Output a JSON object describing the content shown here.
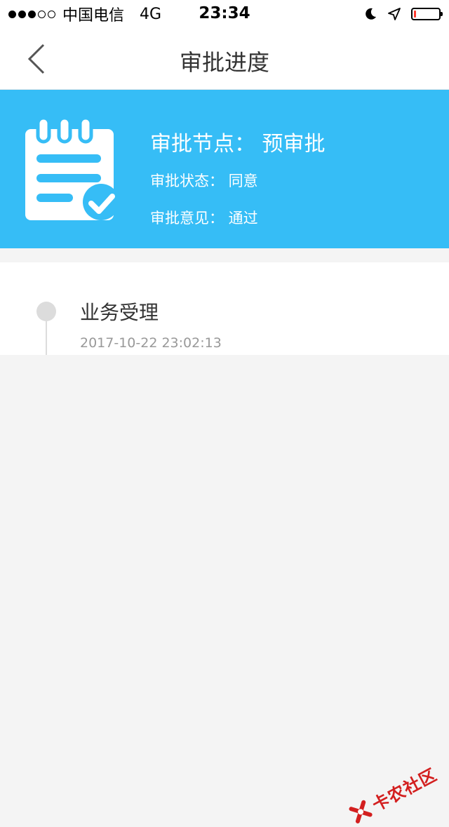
{
  "status_bar": {
    "carrier": "中国电信",
    "network": "4G",
    "time": "23:34",
    "signal_bars_filled": 3,
    "signal_bars_total": 5,
    "battery_level": 0.1,
    "battery_color": "#ff3b30",
    "icons": [
      "moon-icon",
      "location-arrow-icon",
      "battery-icon"
    ]
  },
  "nav": {
    "title": "审批进度",
    "back_icon": "chevron-left-icon"
  },
  "banner": {
    "background": "#36bdf6",
    "icon": "clipboard-check-icon",
    "node": "审批节点：  预审批",
    "status": "审批状态：  同意",
    "opinion": "审批意见：  通过"
  },
  "timeline": {
    "items": [
      {
        "title": "业务受理",
        "time": "2017-10-22 23:02:13"
      }
    ]
  },
  "watermark": {
    "text": "卡农社区"
  }
}
